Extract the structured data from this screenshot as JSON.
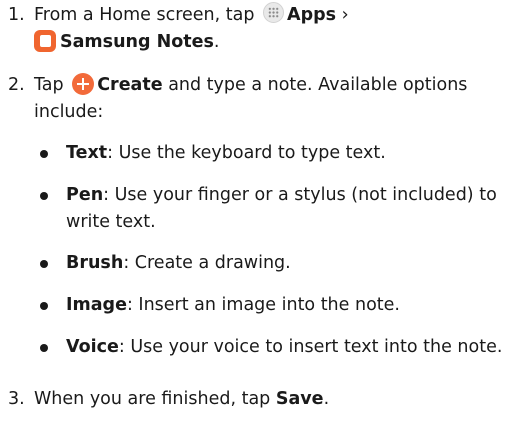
{
  "steps": [
    {
      "number": "1.",
      "prefix": "From a Home screen, tap",
      "apps_label": "Apps",
      "chevron": "›",
      "notes_label": "Samsung Notes",
      "suffix": "."
    },
    {
      "number": "2.",
      "prefix": "Tap",
      "create_label": "Create",
      "suffix": "and type a note. Available options include:"
    },
    {
      "number": "3.",
      "prefix": "When you are finished, tap",
      "save_label": "Save",
      "suffix": "."
    }
  ],
  "options": [
    {
      "term": "Text",
      "desc": ": Use the keyboard to type text."
    },
    {
      "term": "Pen",
      "desc": ": Use your finger or a stylus (not included) to write text."
    },
    {
      "term": "Brush",
      "desc": ": Create a drawing."
    },
    {
      "term": "Image",
      "desc": ": Insert an image into the note."
    },
    {
      "term": "Voice",
      "desc": ": Use your voice to insert text into the note."
    }
  ],
  "icons": {
    "apps": "apps-grid-icon",
    "notes": "samsung-notes-app-icon",
    "create": "plus-create-icon",
    "bullet": "bullet-dot"
  },
  "colors": {
    "text": "#1a1a1a",
    "accent_orange": "#f26a3a",
    "notes_icon": "#f0652f"
  }
}
